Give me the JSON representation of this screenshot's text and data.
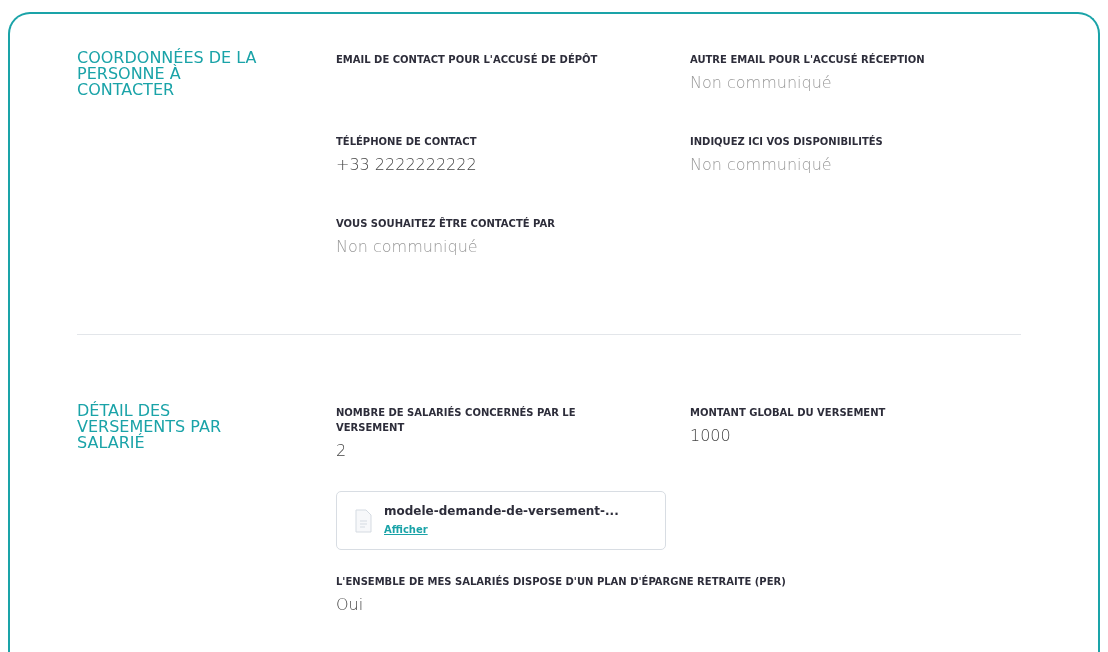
{
  "sections": [
    {
      "title": "COORDONNÉES DE LA PERSONNE À CONTACTER",
      "fields": [
        {
          "kind": "field",
          "label": "EMAIL DE CONTACT POUR L'ACCUSÉ DE DÉPÔT"
        },
        {
          "kind": "field",
          "label": "AUTRE EMAIL POUR L'ACCUSÉ RÉCEPTION",
          "value": "Non communiqué",
          "missing": true
        },
        {
          "kind": "field",
          "label": "TÉLÉPHONE DE CONTACT",
          "value": "+33 2222222222",
          "missing": false
        },
        {
          "kind": "field",
          "label": "INDIQUEZ ICI VOS DISPONIBILITÉS",
          "value": "Non communiqué",
          "missing": true
        },
        {
          "kind": "field",
          "label": "VOUS SOUHAITEZ ÊTRE CONTACTÉ PAR",
          "value": "Non communiqué",
          "missing": true
        }
      ]
    },
    {
      "title": "DÉTAIL DES VERSEMENTS PAR SALARIÉ",
      "fields": [
        {
          "kind": "field",
          "label": "NOMBRE DE SALARIÉS CONCERNÉS PAR LE VERSEMENT",
          "value": "2",
          "missing": false
        },
        {
          "kind": "field",
          "label": "MONTANT GLOBAL DU VERSEMENT",
          "value": "1000",
          "missing": false
        },
        {
          "kind": "file",
          "name": "modele-demande-de-versement-...",
          "link": "Afficher"
        },
        {
          "kind": "wide",
          "label": "L'ENSEMBLE DE MES SALARIÉS DISPOSE D'UN PLAN D'ÉPARGNE RETRAITE (PER)",
          "value": "Oui",
          "missing": false
        }
      ]
    }
  ]
}
